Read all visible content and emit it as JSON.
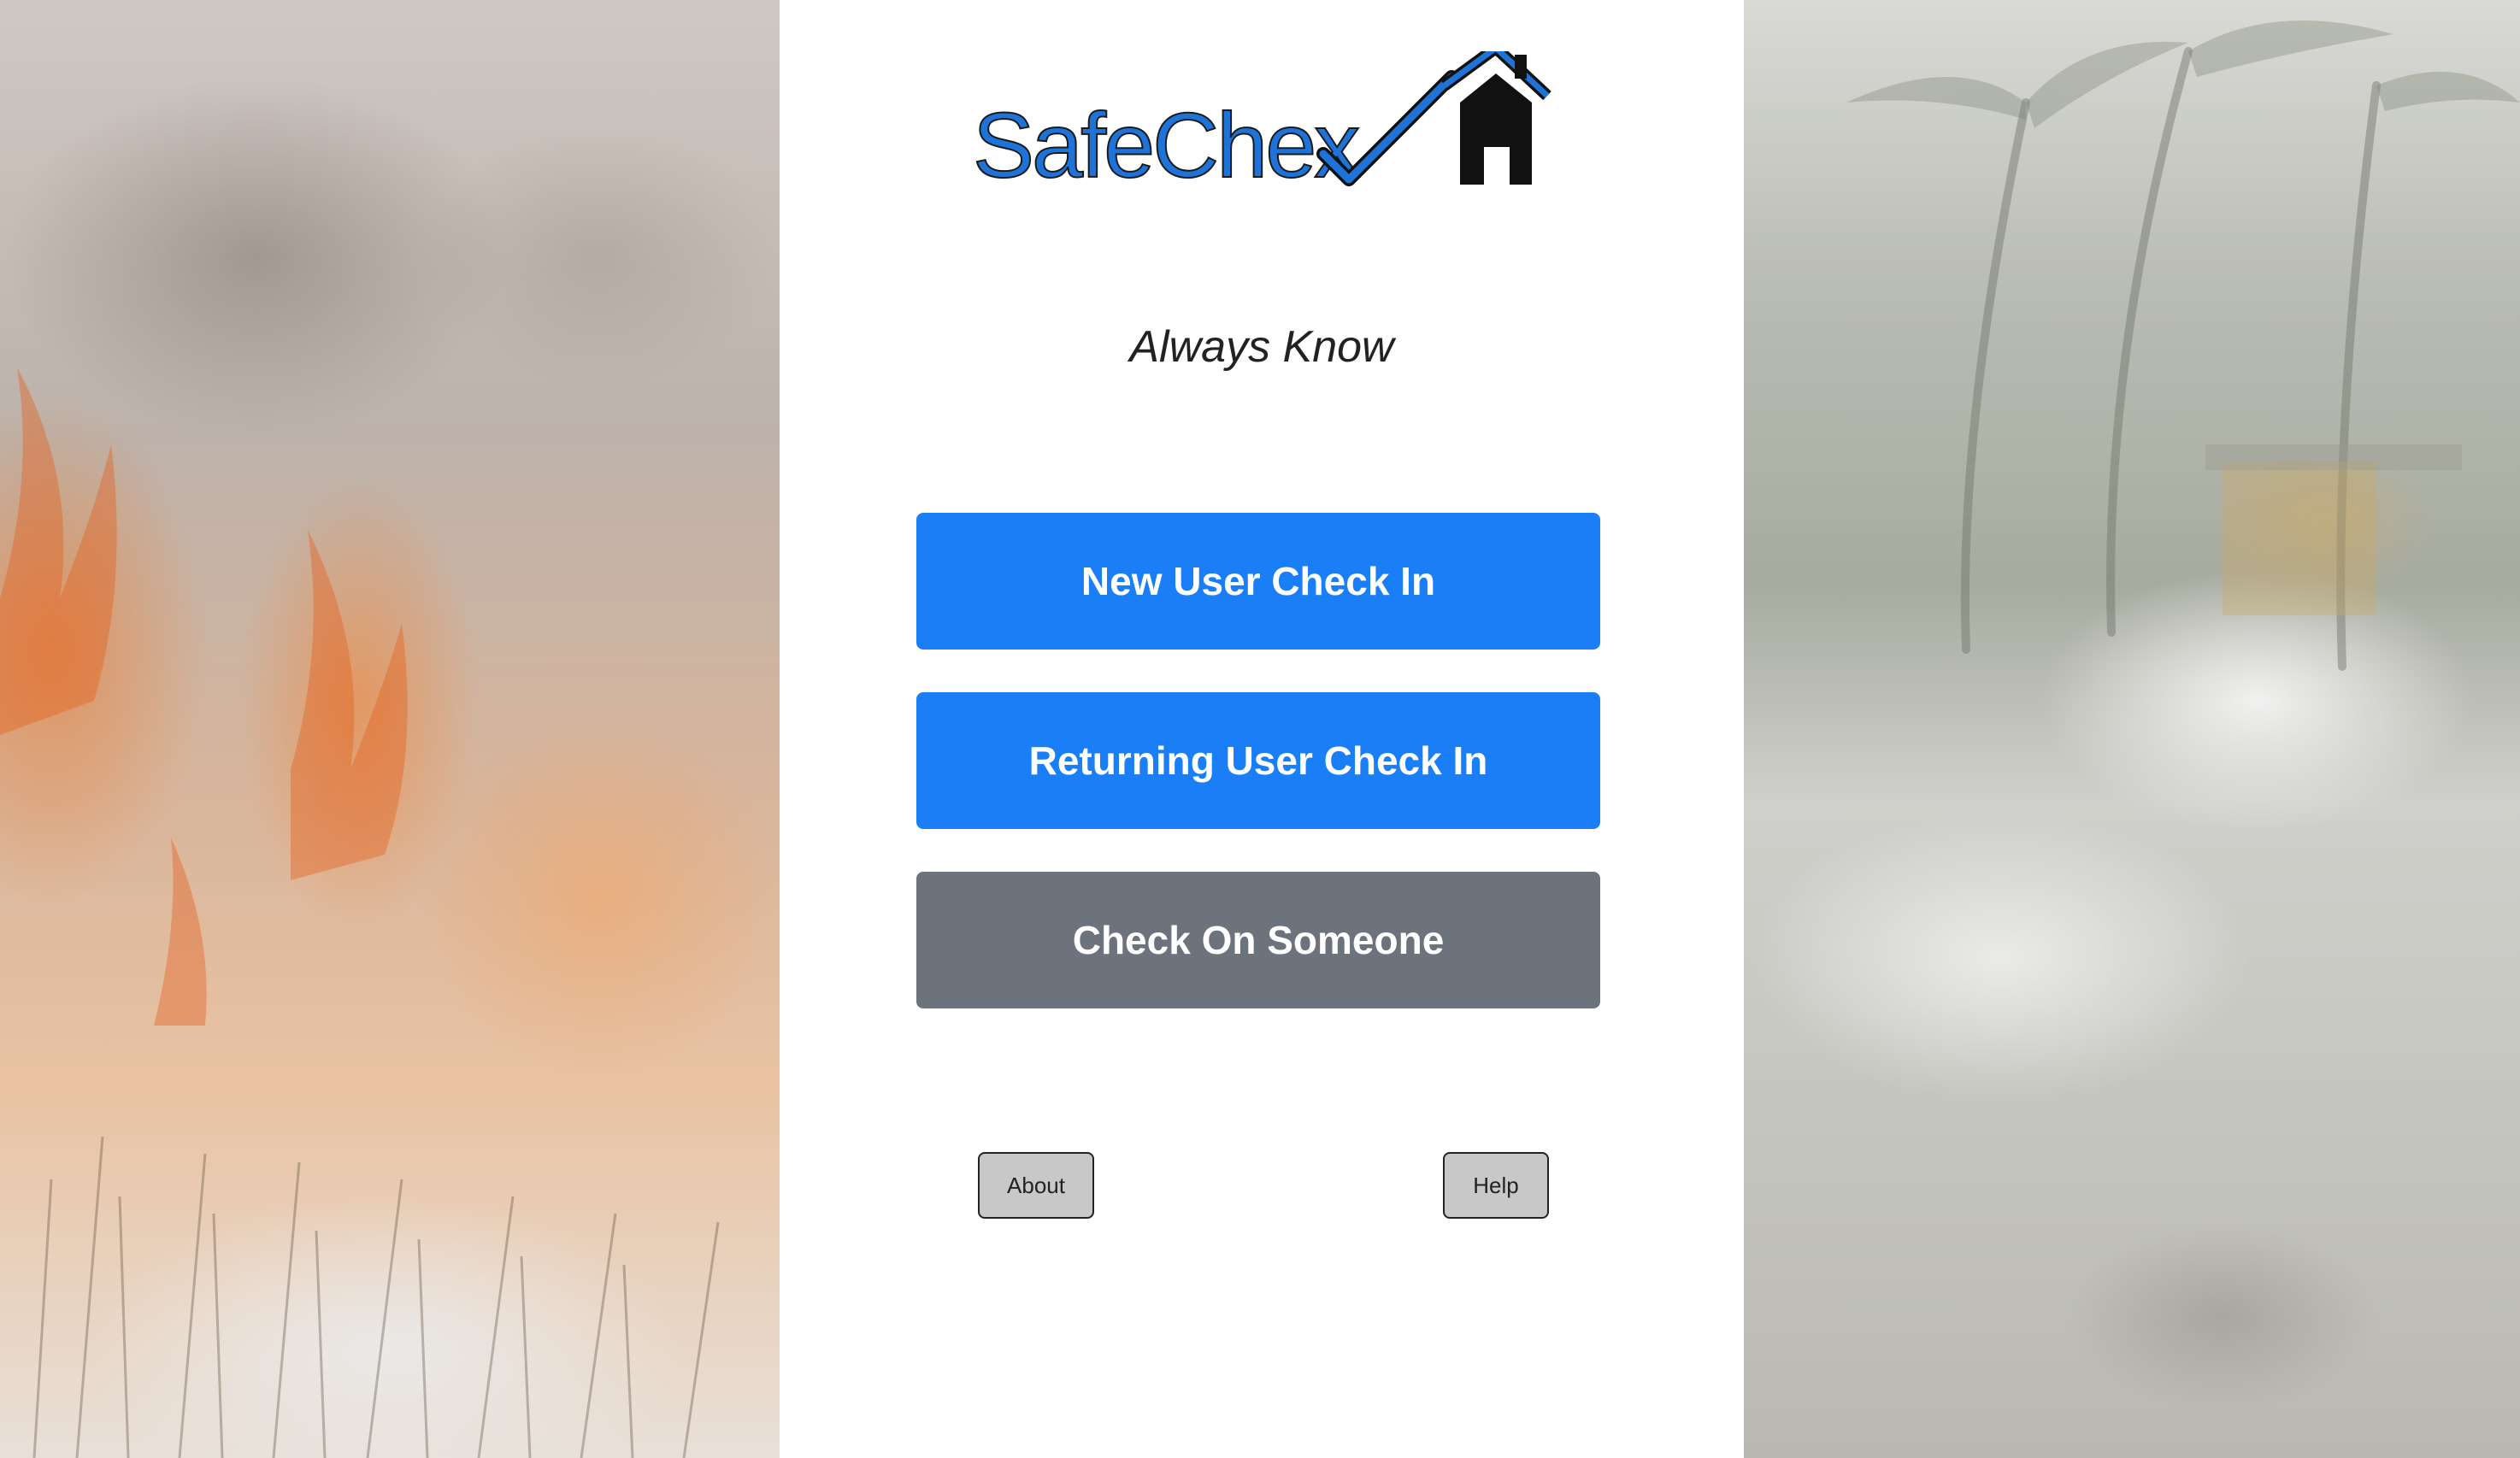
{
  "brand": {
    "logo_text_part1": "Safe",
    "logo_text_part2": "Che",
    "logo_text_part3": "x",
    "logo_icon": "house-check-icon",
    "logo_colors": {
      "blue": "#1e73d8",
      "black": "#111111"
    }
  },
  "tagline": "Always Know",
  "actions": {
    "new_user": "New User Check In",
    "returning_user": "Returning User Check In",
    "check_on_someone": "Check On Someone"
  },
  "footer": {
    "about_label": "About",
    "help_label": "Help"
  },
  "colors": {
    "primary": "#1a7ff6",
    "secondary": "#6c737c",
    "small_button_bg": "#c8c8c8"
  },
  "background_images": {
    "left": "wildfire-photo",
    "right": "hurricane-storm-photo"
  }
}
